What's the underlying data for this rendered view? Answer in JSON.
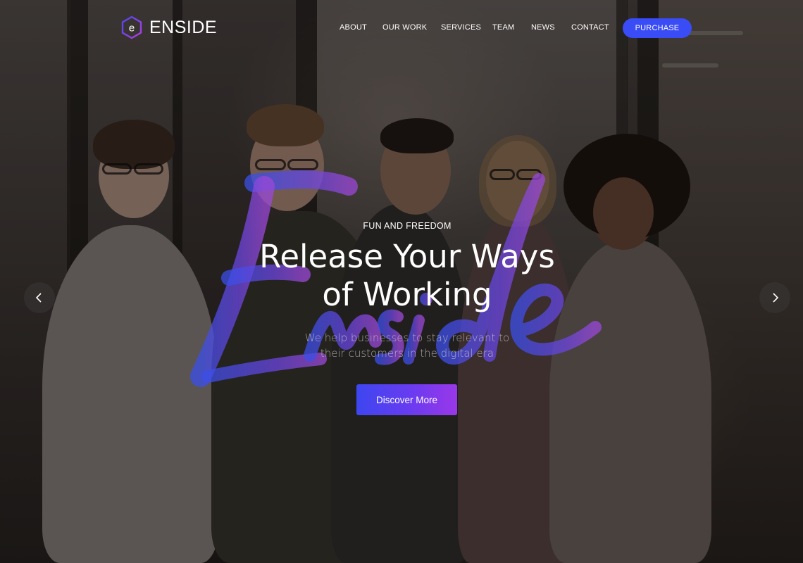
{
  "brand": {
    "logo_letter": "e",
    "name": "ENSIDE",
    "accent_color": "#3a4cf5",
    "gradient_colors": [
      "#3d46f0",
      "#9a38e8"
    ]
  },
  "nav": {
    "items": [
      {
        "label": "ABOUT"
      },
      {
        "label": "OUR WORK"
      },
      {
        "label": "SERVICES"
      },
      {
        "label": "TEAM"
      },
      {
        "label": "NEWS"
      },
      {
        "label": "CONTACT"
      }
    ],
    "purchase_label": "PURCHASE"
  },
  "hero": {
    "eyebrow": "FUN AND FREEDOM",
    "headline_line1": "Release Your Ways",
    "headline_line2": "of Working",
    "subtitle_line1": "We help businesses to stay relevant to",
    "subtitle_line2": "their customers in the digital era",
    "cta_label": "Discover More",
    "script_word": "Enside"
  },
  "slider": {
    "prev_icon": "chevron-left-icon",
    "next_icon": "chevron-right-icon"
  }
}
